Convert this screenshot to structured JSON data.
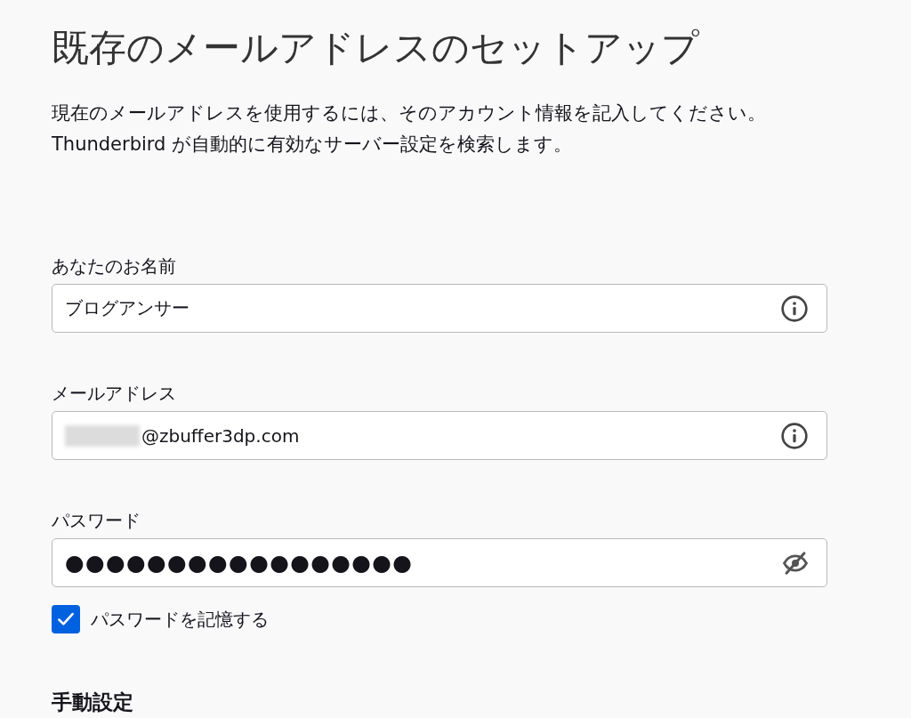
{
  "title": "既存のメールアドレスのセットアップ",
  "description": [
    "現在のメールアドレスを使用するには、そのアカウント情報を記入してください。",
    "Thunderbird が自動的に有効なサーバー設定を検索します。"
  ],
  "fields": [
    {
      "kind": "text",
      "label": "あなたのお名前",
      "value": "ブログアンサー"
    },
    {
      "kind": "email",
      "label": "メールアドレス",
      "value": "@zbuffer3dp.com",
      "redacted": true
    },
    {
      "kind": "password",
      "label": "パスワード",
      "value": "●●●●●●●●●●●●●●●●●"
    }
  ],
  "remember_password": {
    "label": "パスワードを記憶する",
    "checked": true
  },
  "section_heading": "手動設定"
}
